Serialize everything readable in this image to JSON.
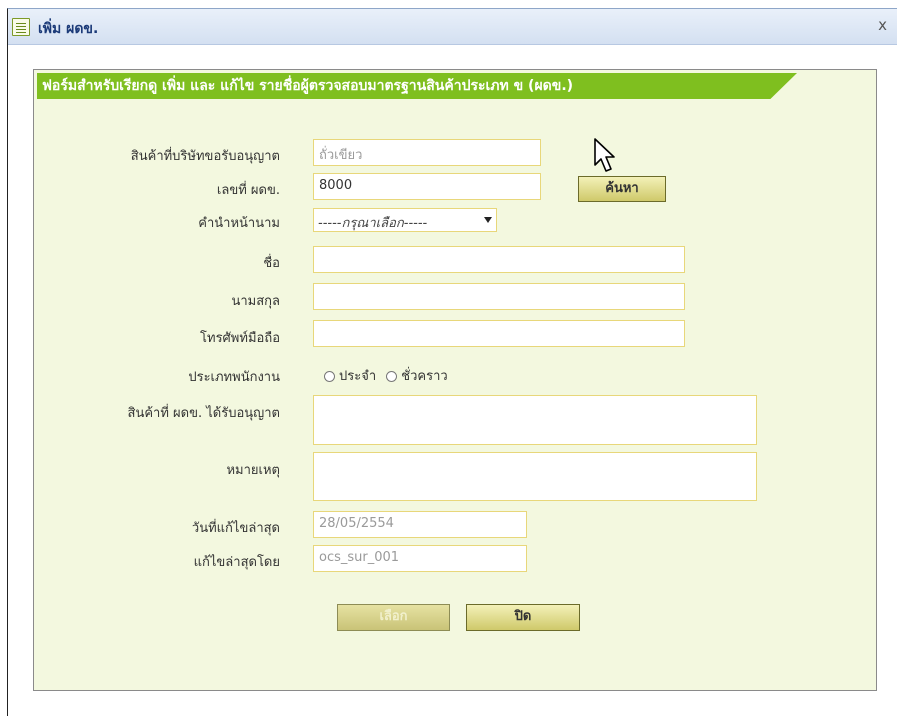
{
  "window": {
    "title": "เพิ่ม ผดข.",
    "close_label": "x"
  },
  "form": {
    "header": "ฟอร์มสำหรับเรียกดู เพิ่ม และ แก้ไข รายชื่อผู้ตรวจสอบมาตรฐานสินค้าประเภท ข (ผดข.)",
    "fields": {
      "licensed_product": {
        "label": "สินค้าที่บริษัทขอรับอนุญาต",
        "value": "ถั่วเขียว"
      },
      "id_number": {
        "label": "เลขที่ ผดข.",
        "value": "8000"
      },
      "title_prefix": {
        "label": "คำนำหน้านาม",
        "value": "-----กรุณาเลือก-----"
      },
      "first_name": {
        "label": "ชื่อ",
        "value": ""
      },
      "last_name": {
        "label": "นามสกุล",
        "value": ""
      },
      "mobile": {
        "label": "โทรศัพท์มือถือ",
        "value": ""
      },
      "employee_type": {
        "label": "ประเภทพนักงาน",
        "options": [
          "ประจำ",
          "ชั่วคราว"
        ]
      },
      "authorized_products": {
        "label": "สินค้าที่ ผดข. ได้รับอนุญาต",
        "value": ""
      },
      "remarks": {
        "label": "หมายเหตุ",
        "value": ""
      },
      "last_edit_date": {
        "label": "วันที่แก้ไขล่าสุด",
        "value": "28/05/2554"
      },
      "last_edited_by": {
        "label": "แก้ไขล่าสุดโดย",
        "value": "ocs_sur_001"
      }
    },
    "search_button": "ค้นหา",
    "select_button": "เลือก",
    "close_button": "ปิด"
  },
  "colors": {
    "header_bg": "#7fbf1f",
    "panel_bg": "#f3f8df",
    "input_border": "#e8d77a",
    "title_text": "#1b3a78"
  }
}
